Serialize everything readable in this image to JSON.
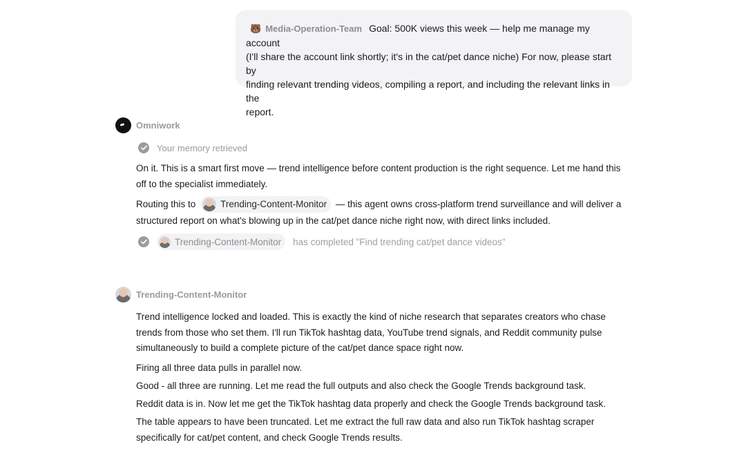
{
  "user_message": {
    "sender_emoji": "🐻",
    "sender_name": "Media-Operation-Team",
    "line1": "Goal: 500K views this week — help me manage my account",
    "line2": "(I'll share the account link shortly; it's in the cat/pet dance niche) For now, please start by",
    "line3": "finding relevant trending videos, compiling a report, and including the relevant links in the",
    "line4": "report."
  },
  "omniwork": {
    "name": "Omniwork",
    "memory_status": "Your memory retrieved",
    "para1_line1": "On it. This is a smart first move — trend intelligence before content production is the right sequence. Let me hand this",
    "para1_line2": "off to the specialist immediately.",
    "routing_prefix": "Routing this to",
    "routing_agent": "Trending-Content-Monitor",
    "routing_suffix": "— this agent owns cross-platform trend surveillance and will deliver a",
    "routing_line2": "structured report on what's blowing up in the cat/pet dance niche right now, with direct links included.",
    "completion_agent": "Trending-Content-Monitor",
    "completion_text": "has completed \"Find trending cat/pet dance videos\""
  },
  "monitor": {
    "name": "Trending-Content-Monitor",
    "p1_line1": "Trend intelligence locked and loaded. This is exactly the kind of niche research that separates creators who chase",
    "p1_line2": "trends from those who set them. I'll run TikTok hashtag data, YouTube trend signals, and Reddit community pulse",
    "p1_line3": "simultaneously to build a complete picture of the cat/pet dance space right now.",
    "p2": "Firing all three data pulls in parallel now.",
    "p3": "Good - all three are running. Let me read the full outputs and also check the Google Trends background task.",
    "p4": "Reddit data is in. Now let me get the TikTok hashtag data properly and check the Google Trends background task.",
    "p5_line1": "The table appears to have been truncated. Let me extract the full raw data and also run TikTok hashtag scraper",
    "p5_line2": "specifically for cat/pet content, and check Google Trends results."
  }
}
